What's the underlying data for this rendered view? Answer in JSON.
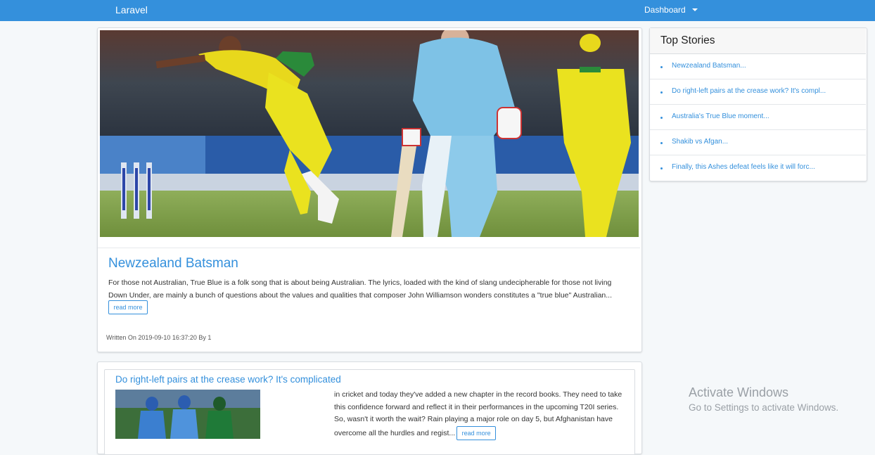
{
  "navbar": {
    "brand": "Laravel",
    "dashboard": "Dashboard",
    "bg": "#3490dc"
  },
  "featured": {
    "title": "Newzealand Batsman",
    "body": "For those not Australian, True Blue is a folk song that is about being Australian. The lyrics, loaded with the kind of slang undecipherable for those not living Down Under, are mainly a bunch of questions about the values and qualities that composer John Williamson wonders constitutes a \"true blue\" Australian...",
    "read_more": "read more",
    "meta": "Written On 2019-09-10 16:37:20 By 1"
  },
  "second": {
    "title": "Do right-left pairs at the crease work? It's complicated",
    "excerpt": "in cricket and today they've added a new chapter in the record books. They need to take this confidence forward and reflect it in their performances in the upcoming T20I series. So, wasn't it worth the wait? Rain playing a major role on day 5, but Afghanistan have overcome all the hurdles and regist...",
    "read_more": "read more"
  },
  "sidebar": {
    "title": "Top Stories",
    "items": [
      {
        "label": "Newzealand Batsman..."
      },
      {
        "label": "Do right-left pairs at the crease work? It's compl..."
      },
      {
        "label": "Australia's True Blue moment..."
      },
      {
        "label": "Shakib vs Afgan..."
      },
      {
        "label": "Finally, this Ashes defeat feels like it will forc..."
      }
    ]
  },
  "watermark": {
    "line1": "Activate Windows",
    "line2": "Go to Settings to activate Windows."
  }
}
